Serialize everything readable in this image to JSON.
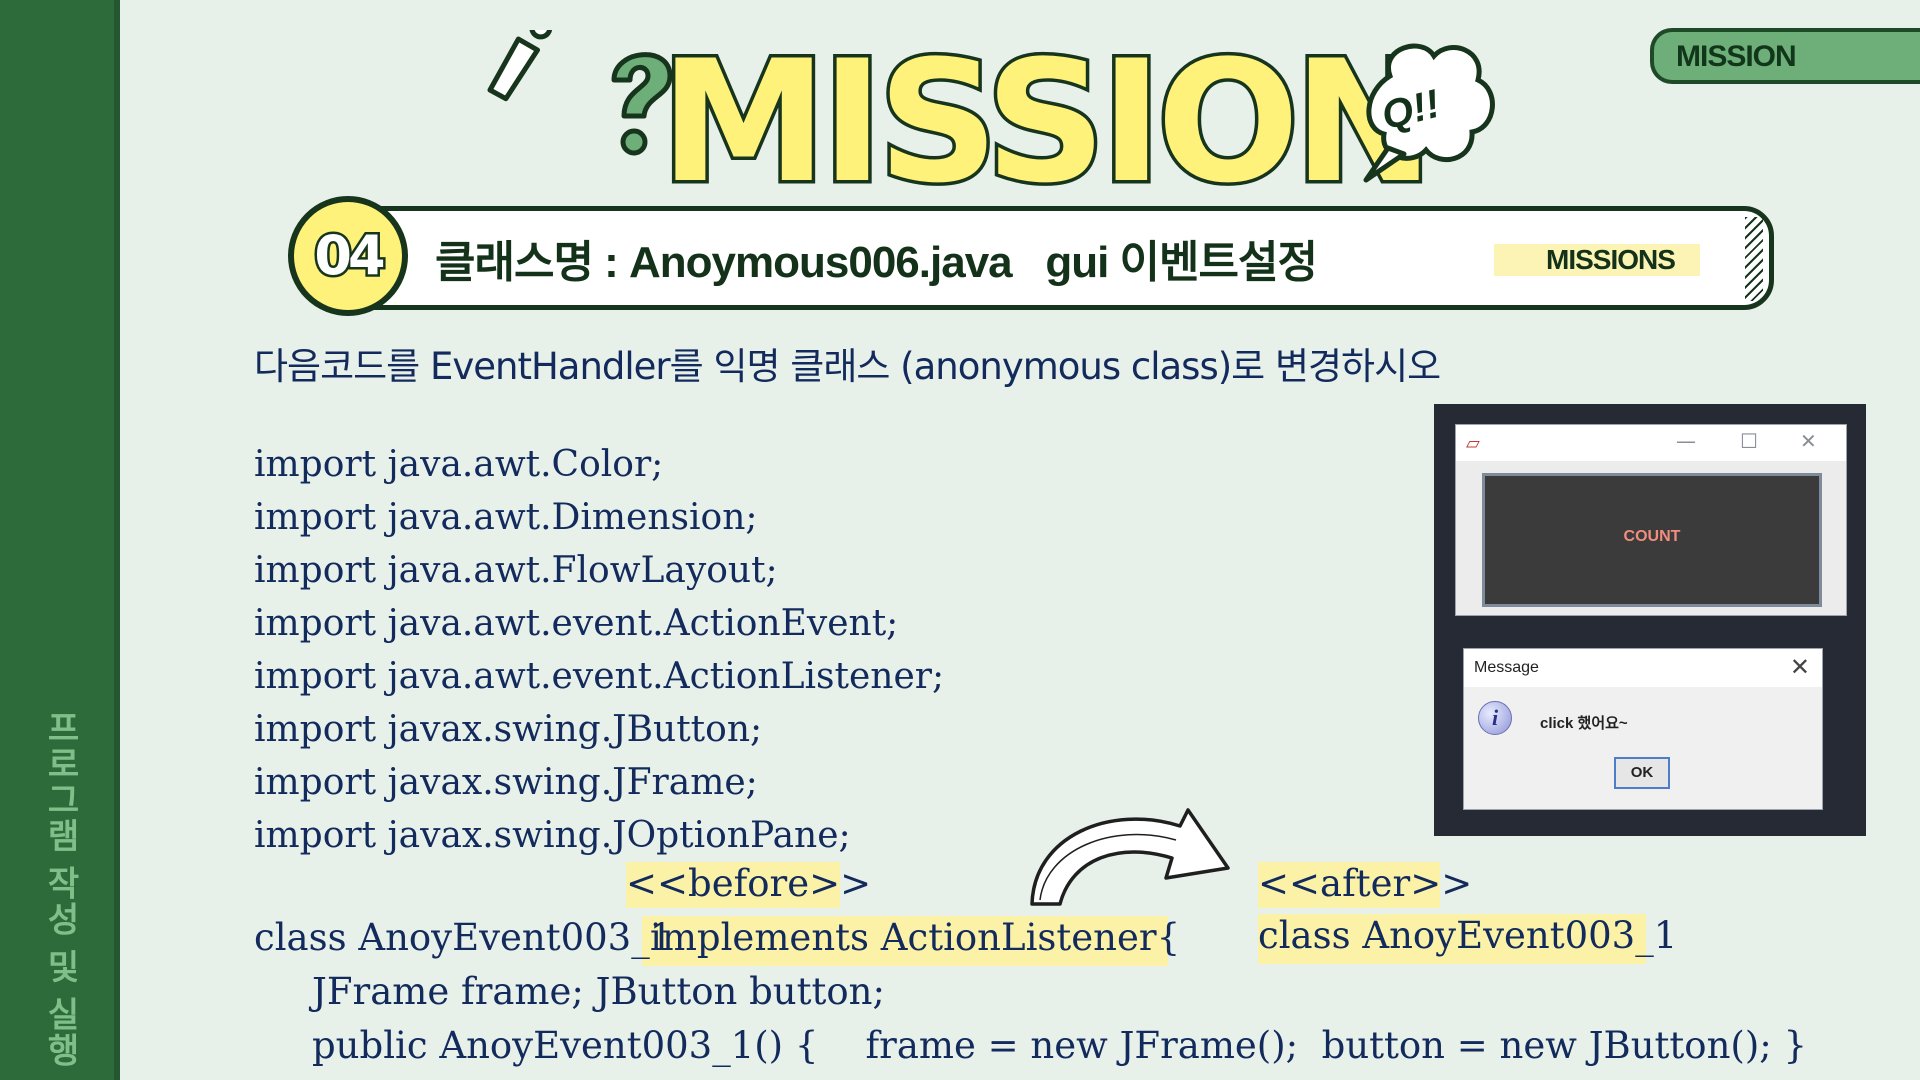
{
  "sidebar": {
    "vertical_text": "프로그램 작성 및 실행"
  },
  "top_tag": {
    "label": "MISSION"
  },
  "header": {
    "title": "MISSION",
    "bubble_text": "Q!!",
    "badge_number": "04",
    "banner_title": "클래스명 : Anoymous006.java   gui 이벤트설정",
    "missions_label": "MISSIONS"
  },
  "instruction": "다음코드를 EventHandler를 익명 클래스 (anonymous class)로 변경하시오",
  "imports": [
    "import java.awt.Color;",
    "import java.awt.Dimension;",
    "import java.awt.FlowLayout;",
    "import java.awt.event.ActionEvent;",
    "import java.awt.event.ActionListener;",
    "import javax.swing.JButton;",
    "import javax.swing.JFrame;",
    "import javax.swing.JOptionPane;"
  ],
  "before_label": "<<before>>",
  "after_label": "<<after>>",
  "code": {
    "class_decl": "class AnoyEvent003_1",
    "implements_part": "implements ActionListener{",
    "after_class": "class AnoyEvent003_1",
    "fields_line": "JFrame frame; JButton button;",
    "constructor_line": "public AnoyEvent003_1() {    frame = new JFrame();  button = new JButton(); }"
  },
  "screenshot": {
    "count_button": "COUNT",
    "window_controls": {
      "minimize": "—",
      "maximize": "☐",
      "close": "✕"
    },
    "dialog": {
      "title": "Message",
      "close": "✕",
      "icon_letter": "i",
      "message": "click 했어요~",
      "ok": "OK"
    }
  },
  "colors": {
    "sidebar": "#2e6b3a",
    "background": "#e8f0ea",
    "title_fill": "#fff27a",
    "highlight": "#fbf2a8",
    "code_text": "#122a5c"
  }
}
